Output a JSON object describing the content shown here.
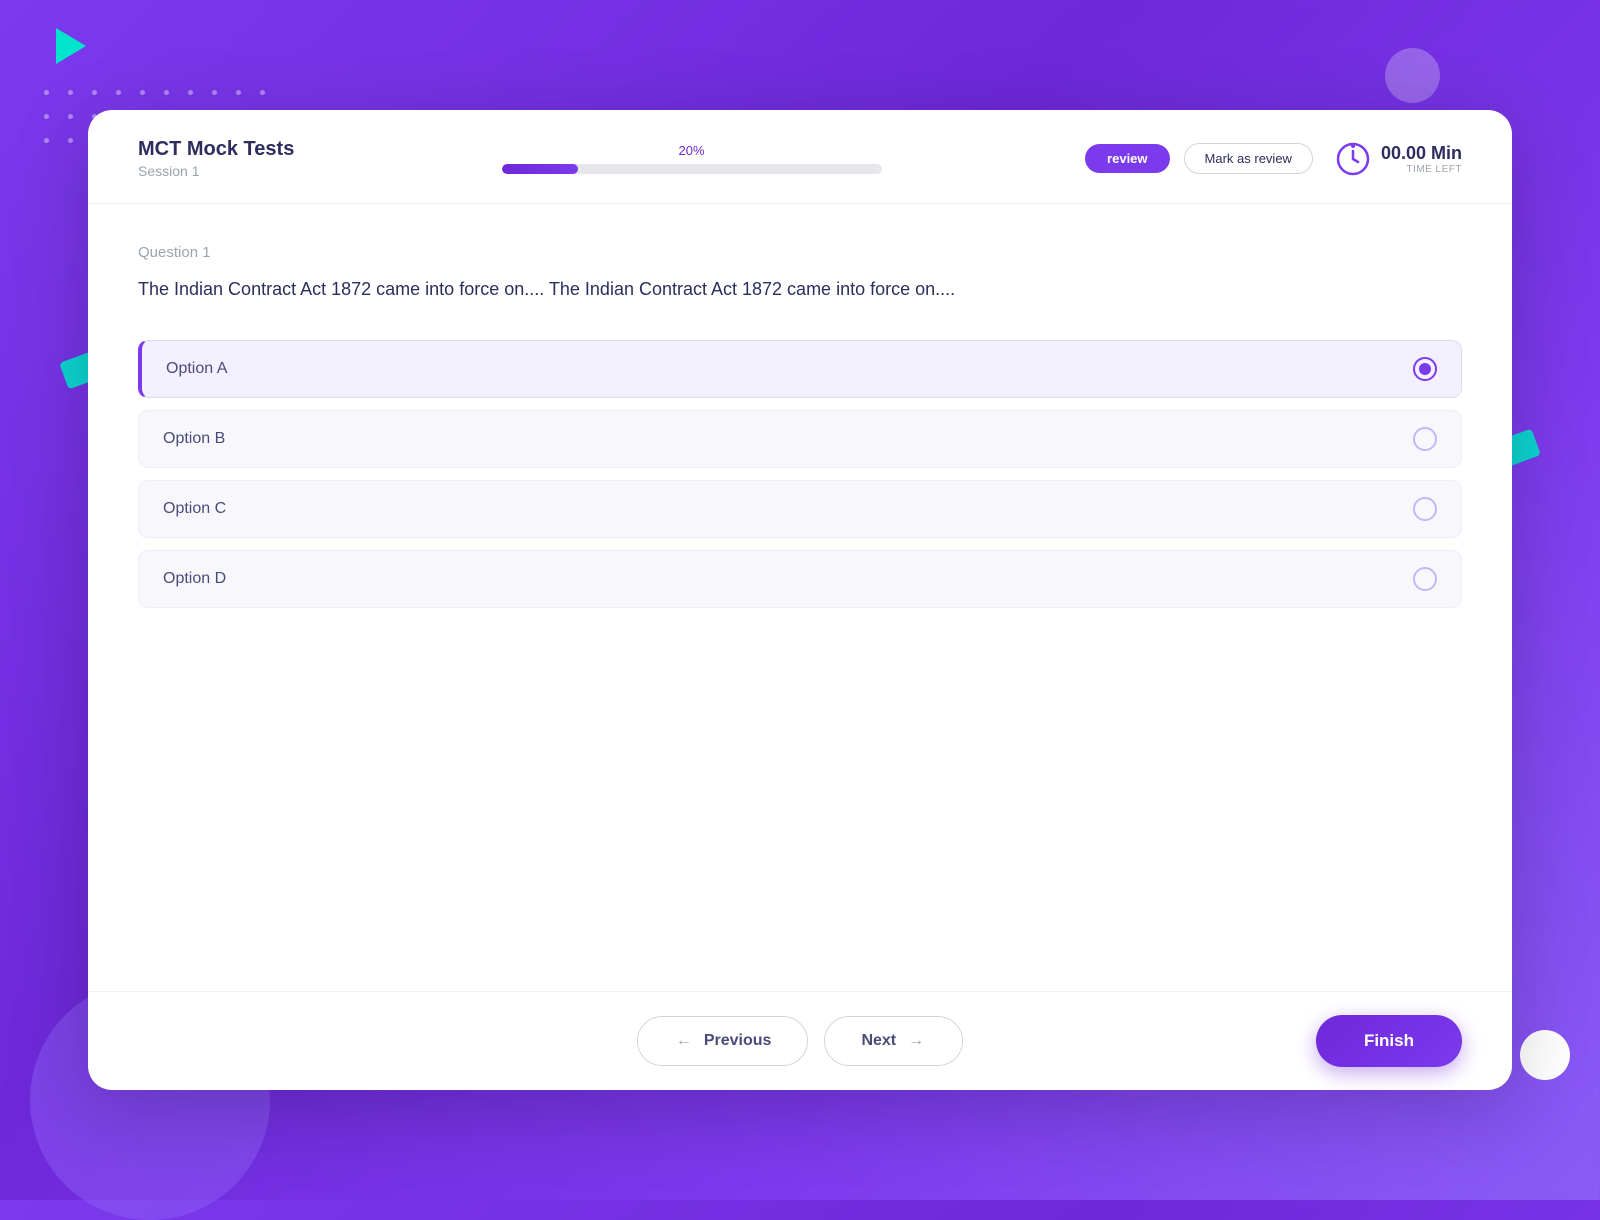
{
  "background": {
    "color": "#7c3aed"
  },
  "header": {
    "title": "MCT Mock Tests",
    "session": "Session 1",
    "progress_percent": "20%",
    "progress_value": 20,
    "btn_review": "review",
    "btn_mark_review": "Mark as review",
    "timer_value": "00.00 Min",
    "timer_label": "Time Left"
  },
  "question": {
    "label": "Question 1",
    "text": "The Indian Contract Act 1872 came into force on.... The Indian Contract Act 1872 came into force on....",
    "options": [
      {
        "id": "A",
        "label": "Option A",
        "selected": true
      },
      {
        "id": "B",
        "label": "Option B",
        "selected": false
      },
      {
        "id": "C",
        "label": "Option C",
        "selected": false
      },
      {
        "id": "D",
        "label": "Option D",
        "selected": false
      }
    ]
  },
  "footer": {
    "prev_label": "Previous",
    "next_label": "Next",
    "finish_label": "Finish"
  }
}
